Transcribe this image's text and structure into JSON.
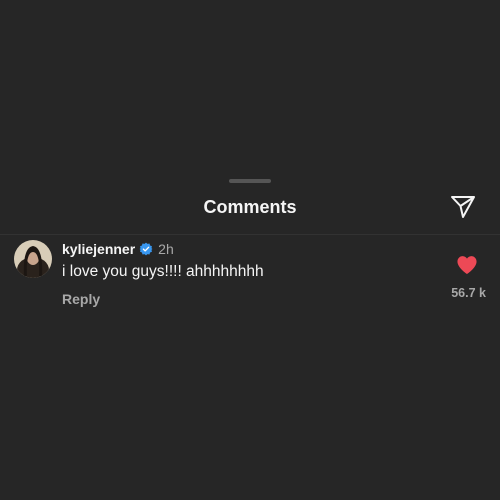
{
  "sheet": {
    "title": "Comments"
  },
  "comment": {
    "username": "kyliejenner",
    "verified": true,
    "time": "2h",
    "text": "i love you guys!!!! ahhhhhhhh",
    "reply_label": "Reply",
    "like_count": "56.7 k",
    "liked": true
  },
  "colors": {
    "background": "#262626",
    "text_primary": "#f5f5f5",
    "text_secondary": "#a8a8a8",
    "verified_blue": "#3897f0",
    "like_red": "#ed4956"
  },
  "icons": {
    "send": "paper-plane-icon",
    "verified": "verified-badge-icon",
    "like": "heart-filled-icon"
  }
}
